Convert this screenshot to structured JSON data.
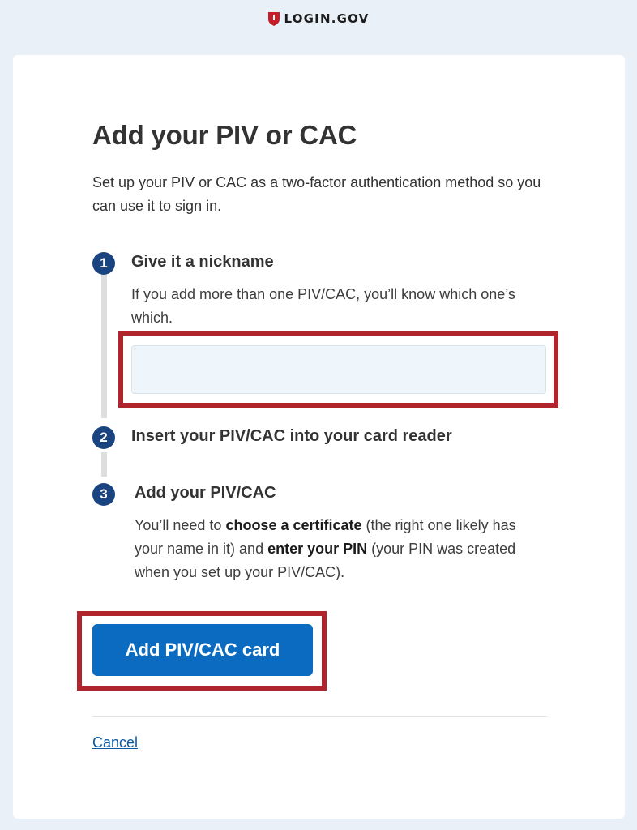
{
  "header": {
    "brand": "LOGIN.GOV",
    "brand_icon": "shield-icon",
    "brand_color": "#c41e28"
  },
  "page": {
    "title": "Add your PIV or CAC",
    "intro": "Set up your PIV or CAC as a two-factor authentication method so you can use it to sign in."
  },
  "steps": [
    {
      "number": "1",
      "title": "Give it a nickname",
      "body": "If you add more than one PIV/CAC, you’ll know which one’s which."
    },
    {
      "number": "2",
      "title": "Insert your PIV/CAC into your card reader"
    },
    {
      "number": "3",
      "title": "Add your PIV/CAC",
      "body_parts": [
        "You’ll need to ",
        "choose a certificate",
        " (the right one likely has your name in it) and ",
        "enter your PIN",
        " (your PIN was created when you set up your PIV/CAC)."
      ]
    }
  ],
  "form": {
    "nickname_value": "",
    "submit_label": "Add PIV/CAC card"
  },
  "footer": {
    "cancel_label": "Cancel"
  },
  "colors": {
    "accent": "#0b6bc1",
    "step_circle": "#1a4480",
    "highlight": "#b0242b",
    "page_bg": "#eaf0f7"
  }
}
